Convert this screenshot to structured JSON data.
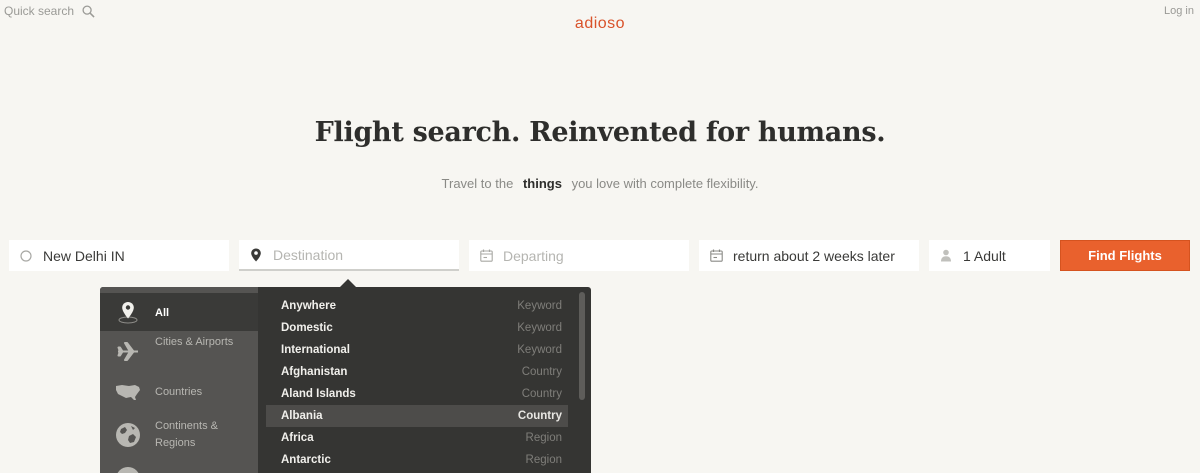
{
  "header": {
    "quick_search": "Quick search",
    "logo": "adioso",
    "login": "Log in"
  },
  "hero": {
    "headline": "Flight search. Reinvented for humans.",
    "tagline_before": "Travel to the",
    "tagline_highlight": "things",
    "tagline_after": "you love with complete flexibility."
  },
  "search": {
    "origin_value": "New Delhi IN",
    "destination_placeholder": "Destination",
    "departing_placeholder": "Departing",
    "return_value": "return about 2 weeks later",
    "passengers_value": "1 Adult",
    "find_button": "Find Flights"
  },
  "dropdown": {
    "categories": [
      {
        "label": "All",
        "icon": "map-pin-icon",
        "active": true
      },
      {
        "label": "Cities & Airports",
        "icon": "airplane-icon",
        "active": false
      },
      {
        "label": "Countries",
        "icon": "usa-map-icon",
        "active": false
      },
      {
        "label": "Continents & Regions",
        "icon": "globe-icon",
        "active": false
      }
    ],
    "results": [
      {
        "name": "Anywhere",
        "type": "Keyword",
        "selected": false
      },
      {
        "name": "Domestic",
        "type": "Keyword",
        "selected": false
      },
      {
        "name": "International",
        "type": "Keyword",
        "selected": false
      },
      {
        "name": "Afghanistan",
        "type": "Country",
        "selected": false
      },
      {
        "name": "Aland Islands",
        "type": "Country",
        "selected": false
      },
      {
        "name": "Albania",
        "type": "Country",
        "selected": true
      },
      {
        "name": "Africa",
        "type": "Region",
        "selected": false
      },
      {
        "name": "Antarctic",
        "type": "Region",
        "selected": false
      }
    ]
  },
  "colors": {
    "background": "#f7f6f2",
    "accent": "#e9612d",
    "logo": "#d9522a",
    "dropdown_bg": "#353533"
  }
}
